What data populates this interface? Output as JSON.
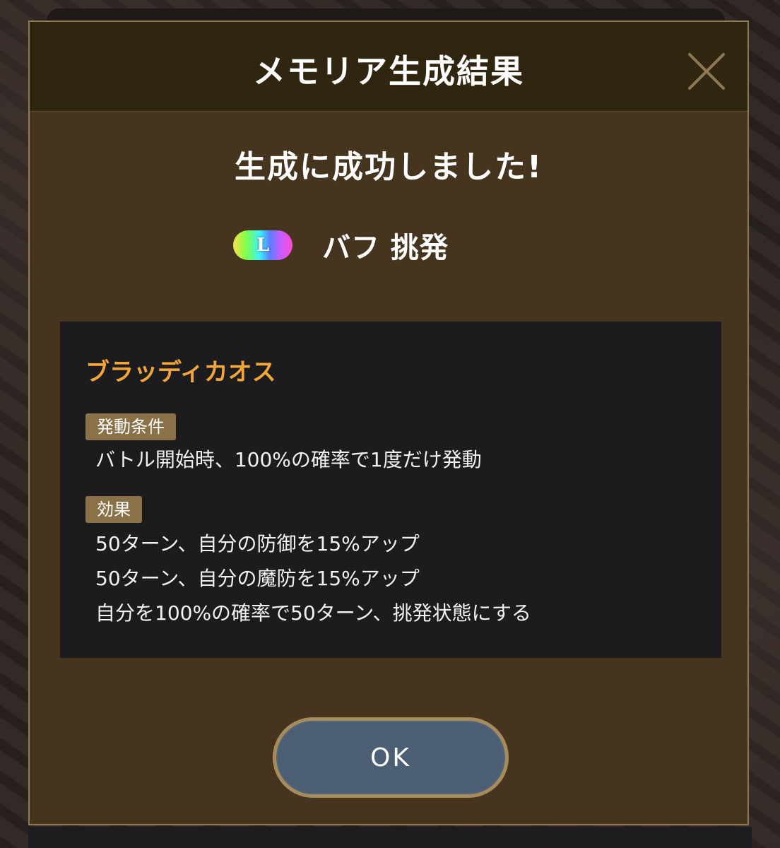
{
  "dialog": {
    "title": "メモリア生成結果",
    "close_icon": "close-icon"
  },
  "result": {
    "message": "生成に成功しました!",
    "rarity": {
      "letter": "L",
      "colors": [
        "#ffe24a",
        "#7cff4a",
        "#3cf2ff",
        "#5a7dff",
        "#c65cff",
        "#ff4ad2"
      ]
    },
    "name": "バフ 挑発"
  },
  "details": {
    "memoria_name": "ブラッディカオス",
    "condition_label": "発動条件",
    "condition_text": "バトル開始時、100%の確率で1度だけ発動",
    "effect_label": "効果",
    "effects": [
      "50ターン、自分の防御を15%アップ",
      "50ターン、自分の魔防を15%アップ",
      "自分を100%の確率で50ターン、挑発状態にする"
    ]
  },
  "actions": {
    "ok_label": "OK"
  },
  "colors": {
    "modal_bg": "#45341e",
    "header_bg": "#30250f",
    "border": "#8f7a55",
    "accent_orange": "#f3a637",
    "tag_bg": "#8a7147",
    "button_bg": "#4c5e74"
  }
}
